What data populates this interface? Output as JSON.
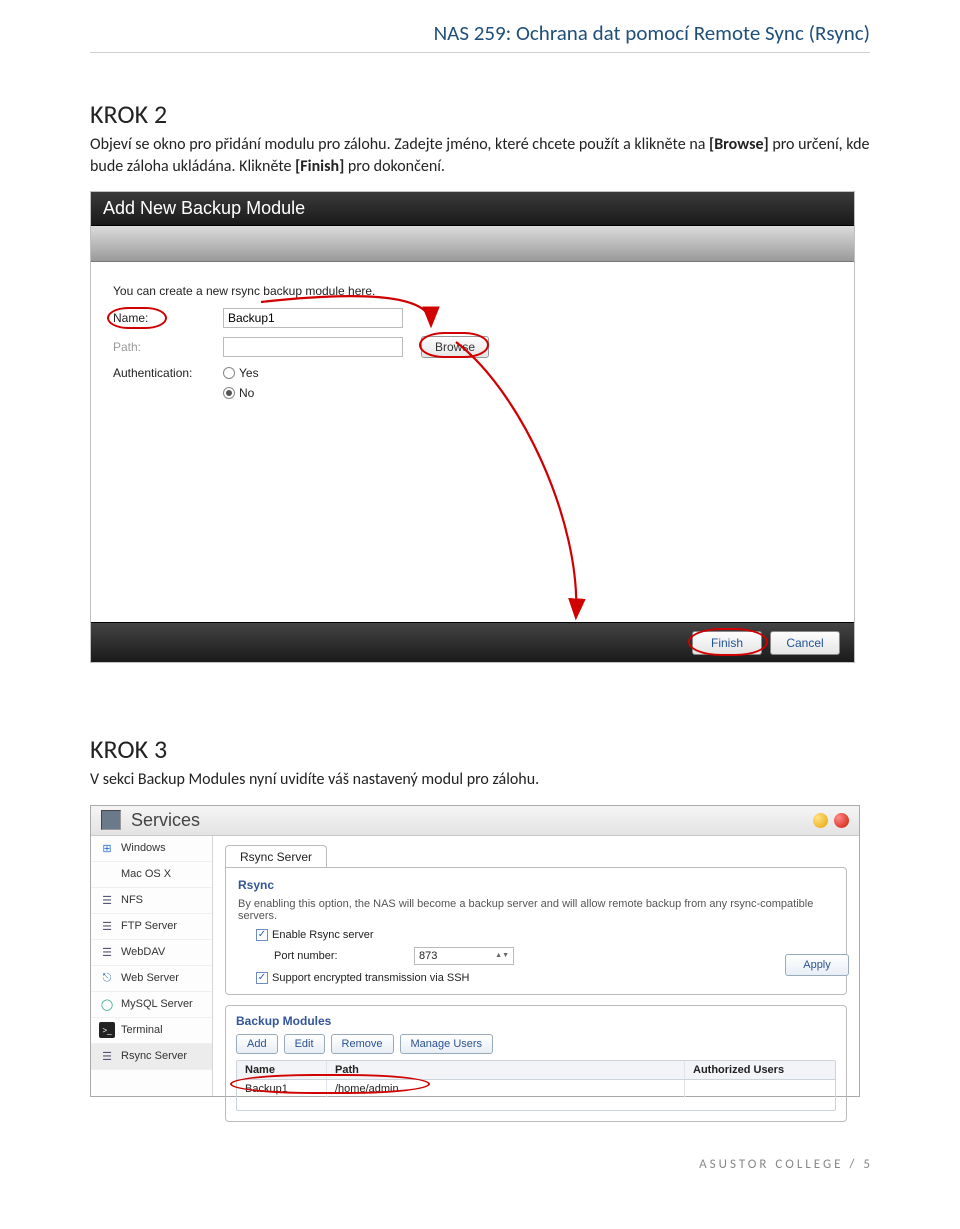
{
  "header": {
    "title": "NAS 259: Ochrana dat pomocí Remote Sync (Rsync)"
  },
  "step2": {
    "title": "KROK 2",
    "text_a": "Objeví se okno pro přidání modulu pro zálohu. Zadejte jméno, které chcete použít a klikněte na ",
    "browse_bold": "[Browse]",
    "text_b": " pro určení, kde bude záloha ukládána. Klikněte ",
    "finish_bold": "[Finish]",
    "text_c": " pro dokončení."
  },
  "dialog": {
    "title": "Add New Backup Module",
    "desc": "You can create a new rsync backup module here.",
    "name_label": "Name:",
    "name_value": "Backup1",
    "path_label": "Path:",
    "path_value": "",
    "browse_btn": "Browse",
    "auth_label": "Authentication:",
    "opt_yes": "Yes",
    "opt_no": "No",
    "finish_btn": "Finish",
    "cancel_btn": "Cancel"
  },
  "step3": {
    "title": "KROK 3",
    "text": "V sekci Backup Modules nyní uvidíte váš nastavený modul pro zálohu."
  },
  "services": {
    "window_title": "Services",
    "sidebar": [
      {
        "label": "Windows",
        "icon": "⊞",
        "color": "#2a72d4"
      },
      {
        "label": "Mac OS X",
        "icon": "",
        "color": "#555"
      },
      {
        "label": "NFS",
        "icon": "☰",
        "color": "#557"
      },
      {
        "label": "FTP Server",
        "icon": "☰",
        "color": "#557"
      },
      {
        "label": "WebDAV",
        "icon": "☰",
        "color": "#557"
      },
      {
        "label": "Web Server",
        "icon": "⎋",
        "color": "#3a7bbd"
      },
      {
        "label": "MySQL Server",
        "icon": "◯",
        "color": "#2a7"
      },
      {
        "label": "Terminal",
        "icon": ">_",
        "color": "#111",
        "inv": true
      },
      {
        "label": "Rsync Server",
        "icon": "☰",
        "color": "#557",
        "selected": true
      }
    ],
    "tab": "Rsync Server",
    "rsync_section": "Rsync",
    "rsync_desc": "By enabling this option, the NAS will become a backup server and will allow remote backup from any rsync-compatible servers.",
    "enable_label": "Enable Rsync server",
    "port_label": "Port number:",
    "port_value": "873",
    "ssh_label": "Support encrypted transmission via SSH",
    "apply_btn": "Apply",
    "bm_section": "Backup Modules",
    "bm_buttons": [
      "Add",
      "Edit",
      "Remove",
      "Manage Users"
    ],
    "bm_headers": {
      "name": "Name",
      "path": "Path",
      "auth": "Authorized Users"
    },
    "bm_row": {
      "name": "Backup1",
      "path": "/home/admin",
      "auth": ""
    }
  },
  "footer": {
    "text": "ASUSTOR COLLEGE / ",
    "page": "5"
  }
}
